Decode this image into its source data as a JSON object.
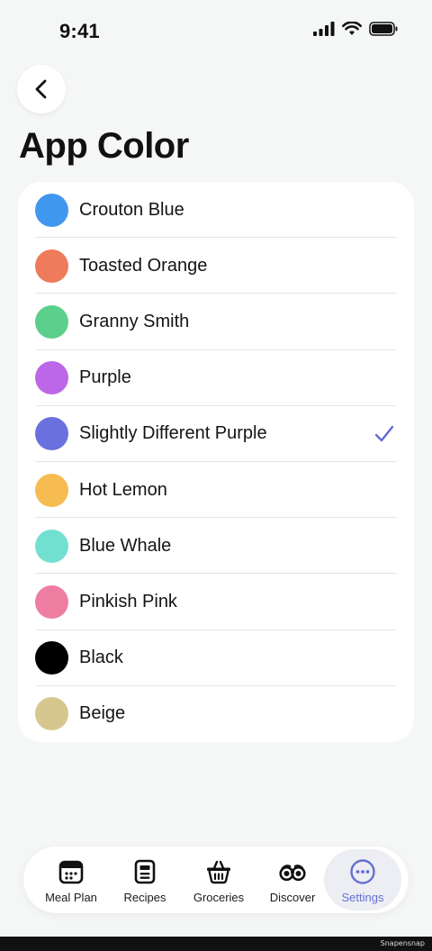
{
  "status_bar": {
    "time": "9:41"
  },
  "header": {
    "title": "App Color",
    "back_icon": "chevron-left-icon"
  },
  "colors": [
    {
      "label": "Crouton Blue",
      "color": "#4097ee",
      "selected": false
    },
    {
      "label": "Toasted Orange",
      "color": "#ee7b5b",
      "selected": false
    },
    {
      "label": "Granny Smith",
      "color": "#5ccf8c",
      "selected": false
    },
    {
      "label": "Purple",
      "color": "#bc67e8",
      "selected": false
    },
    {
      "label": "Slightly Different Purple",
      "color": "#6a71df",
      "selected": true
    },
    {
      "label": "Hot Lemon",
      "color": "#f6bc52",
      "selected": false
    },
    {
      "label": "Blue Whale",
      "color": "#72e0d0",
      "selected": false
    },
    {
      "label": "Pinkish Pink",
      "color": "#ee7ea1",
      "selected": false
    },
    {
      "label": "Black",
      "color": "#000000",
      "selected": false
    },
    {
      "label": "Beige",
      "color": "#d6c78f",
      "selected": false
    }
  ],
  "accent": "#5f6bd5",
  "tabs": [
    {
      "label": "Meal Plan",
      "icon": "calendar-icon",
      "active": false
    },
    {
      "label": "Recipes",
      "icon": "recipe-card-icon",
      "active": false
    },
    {
      "label": "Groceries",
      "icon": "basket-icon",
      "active": false
    },
    {
      "label": "Discover",
      "icon": "binoculars-icon",
      "active": false
    },
    {
      "label": "Settings",
      "icon": "more-circle-icon",
      "active": true
    }
  ],
  "watermark": "Snapensnap"
}
